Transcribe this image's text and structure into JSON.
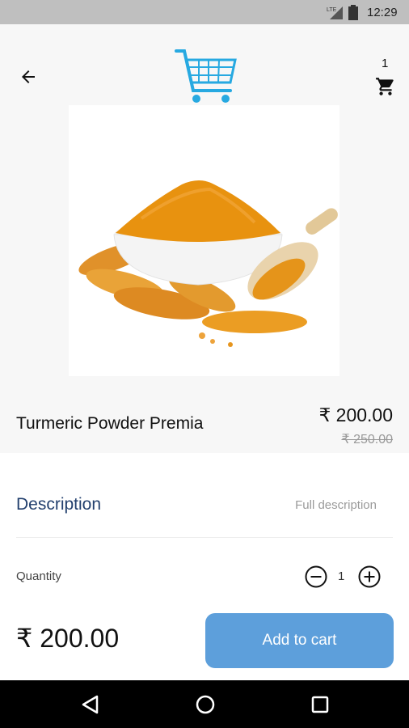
{
  "status_bar": {
    "network": "LTE",
    "time": "12:29"
  },
  "header": {
    "back_icon": "arrow-left-icon",
    "logo_icon": "shopping-cart-logo-icon",
    "cart_count": "1",
    "cart_icon": "cart-icon"
  },
  "product": {
    "image_icon": "turmeric-powder-image",
    "name": "Turmeric Powder Premia",
    "price": "₹ 200.00",
    "old_price": "₹ 250.00"
  },
  "details": {
    "description_label": "Description",
    "full_description_link": "Full description",
    "quantity_label": "Quantity",
    "quantity_value": "1"
  },
  "footer": {
    "total_price": "₹ 200.00",
    "add_to_cart_label": "Add to cart"
  },
  "colors": {
    "accent": "#5d9fdb",
    "logo": "#27a9e1",
    "description_label": "#23406e",
    "turmeric": "#e8920f"
  }
}
